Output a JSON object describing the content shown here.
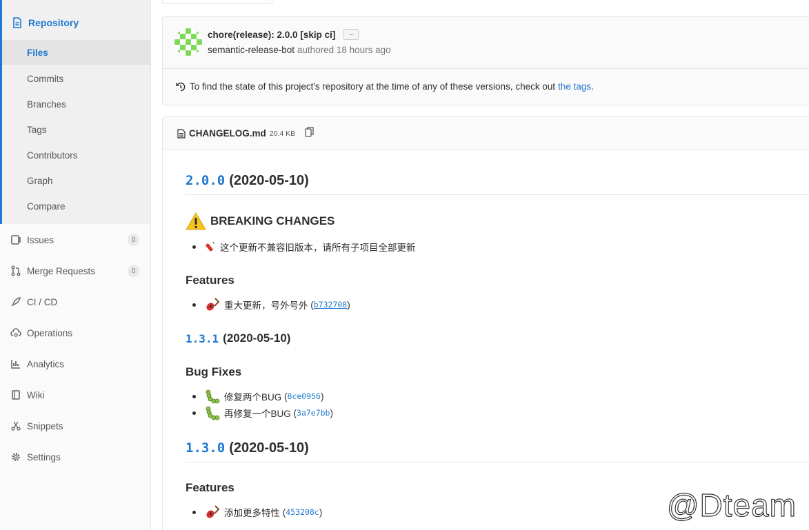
{
  "sidebar": {
    "repo_label": "Repository",
    "sub_items": [
      {
        "label": "Files"
      },
      {
        "label": "Commits"
      },
      {
        "label": "Branches"
      },
      {
        "label": "Tags"
      },
      {
        "label": "Contributors"
      },
      {
        "label": "Graph"
      },
      {
        "label": "Compare"
      }
    ],
    "items": [
      {
        "label": "Issues",
        "count": "0",
        "icon": "issues-icon"
      },
      {
        "label": "Merge Requests",
        "count": "0",
        "icon": "merge-request-icon"
      },
      {
        "label": "CI / CD",
        "icon": "rocket-icon"
      },
      {
        "label": "Operations",
        "icon": "cloud-gear-icon"
      },
      {
        "label": "Analytics",
        "icon": "chart-icon"
      },
      {
        "label": "Wiki",
        "icon": "book-icon"
      },
      {
        "label": "Snippets",
        "icon": "scissors-icon"
      },
      {
        "label": "Settings",
        "icon": "gear-icon"
      }
    ]
  },
  "commit": {
    "title": "chore(release): 2.0.0 [skip ci]",
    "more": "···",
    "author": "semantic-release-bot",
    "meta": "authored 18 hours ago",
    "tags_note": "To find the state of this project's repository at the time of any of these versions, check out",
    "tags_link": "the tags",
    "tags_tail": "."
  },
  "file": {
    "name": "CHANGELOG.md",
    "size": "20.4 KB"
  },
  "changelog": {
    "v200": {
      "version": "2.0.0",
      "date": "(2020-05-10)"
    },
    "breaking_heading": "BREAKING CHANGES",
    "breaking_item": "这个更新不兼容旧版本，请所有子项目全部更新",
    "features1_heading": "Features",
    "features1_item": "重大更新，号外号外",
    "features1_hash": "b732708",
    "v131": {
      "version": "1.3.1",
      "date": "(2020-05-10)"
    },
    "bugfix_heading": "Bug Fixes",
    "bugfix_items": [
      {
        "text": "修复两个BUG",
        "hash": "8ce0956"
      },
      {
        "text": "再修复一个BUG",
        "hash": "3a7e7bb"
      }
    ],
    "v130": {
      "version": "1.3.0",
      "date": "(2020-05-10)"
    },
    "features2_heading": "Features",
    "features2_item": "添加更多特性",
    "features2_hash": "453208c"
  },
  "watermark": "@Dteam",
  "colors": {
    "accent": "#1f78d1",
    "sidebar_bg": "#fafafa",
    "active_bg": "#e4e4e4"
  }
}
